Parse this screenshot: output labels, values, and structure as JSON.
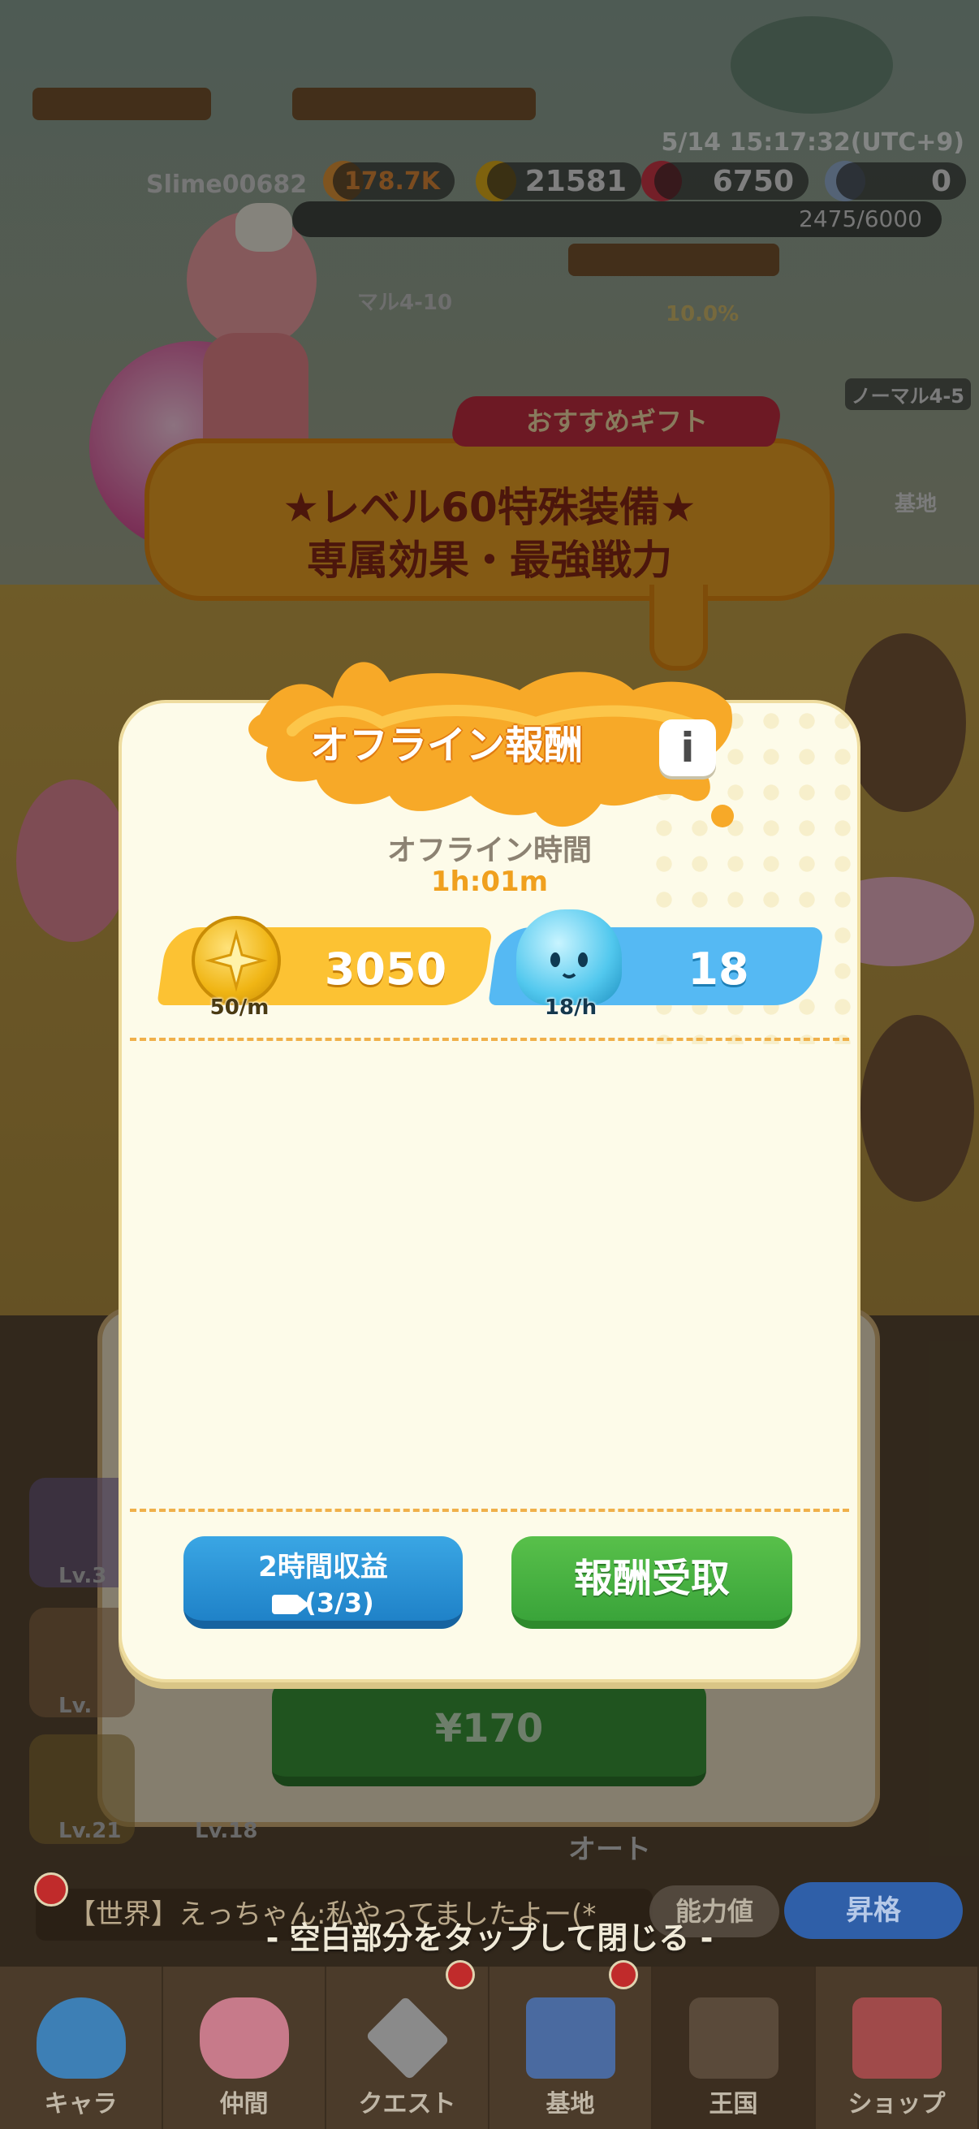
{
  "hud": {
    "datetime": "5/14 15:17:32(UTC+9)",
    "username": "Slime00682",
    "power": "178.7K",
    "gold": "21581",
    "gems": "6750",
    "crystals": "0",
    "exp": "2475/6000",
    "stage": "マル4-10",
    "stage_progress": "10.0%",
    "stage_right": "ノーマル4-5",
    "base_label": "基地"
  },
  "gift_banner": {
    "tag": "おすすめギフト",
    "line1": "★レベル60特殊装備★",
    "line2": "専属効果・最強戦力"
  },
  "modal": {
    "title": "オフライン報酬",
    "info_icon": "i",
    "offline_label": "オフライン時間",
    "offline_time": "1h:01m",
    "rewards": [
      {
        "icon": "gold-coin-icon",
        "value": "3050",
        "rate": "50/m"
      },
      {
        "icon": "blue-slime-icon",
        "value": "18",
        "rate": "18/h"
      }
    ],
    "double_button": {
      "line1": "2時間収益",
      "line2": "(3/3)"
    },
    "claim_button": "報酬受取"
  },
  "shop_card": {
    "price": "¥170",
    "auto_label": "オート"
  },
  "side_levels": [
    "Lv.3",
    "Lv.",
    "Lv.21",
    "Lv.18"
  ],
  "chat": {
    "text": "【世界】えっちゃん:私やってましたよー(*"
  },
  "buttons": {
    "ability": "能力値",
    "upgrade": "昇格"
  },
  "close_hint": "- 空白部分をタップして閉じる -",
  "nav": [
    {
      "label": "キャラ",
      "icon": "slime-character-icon"
    },
    {
      "label": "仲間",
      "icon": "companions-icon"
    },
    {
      "label": "クエスト",
      "icon": "swords-icon"
    },
    {
      "label": "基地",
      "icon": "house-icon"
    },
    {
      "label": "王国",
      "icon": "locked-kingdom-icon"
    },
    {
      "label": "ショップ",
      "icon": "shop-icon"
    }
  ],
  "colors": {
    "accent_orange": "#f0a01e",
    "claim_green": "#3aa43a",
    "video_blue": "#1f82c8",
    "modal_bg": "#fdfbe9"
  }
}
